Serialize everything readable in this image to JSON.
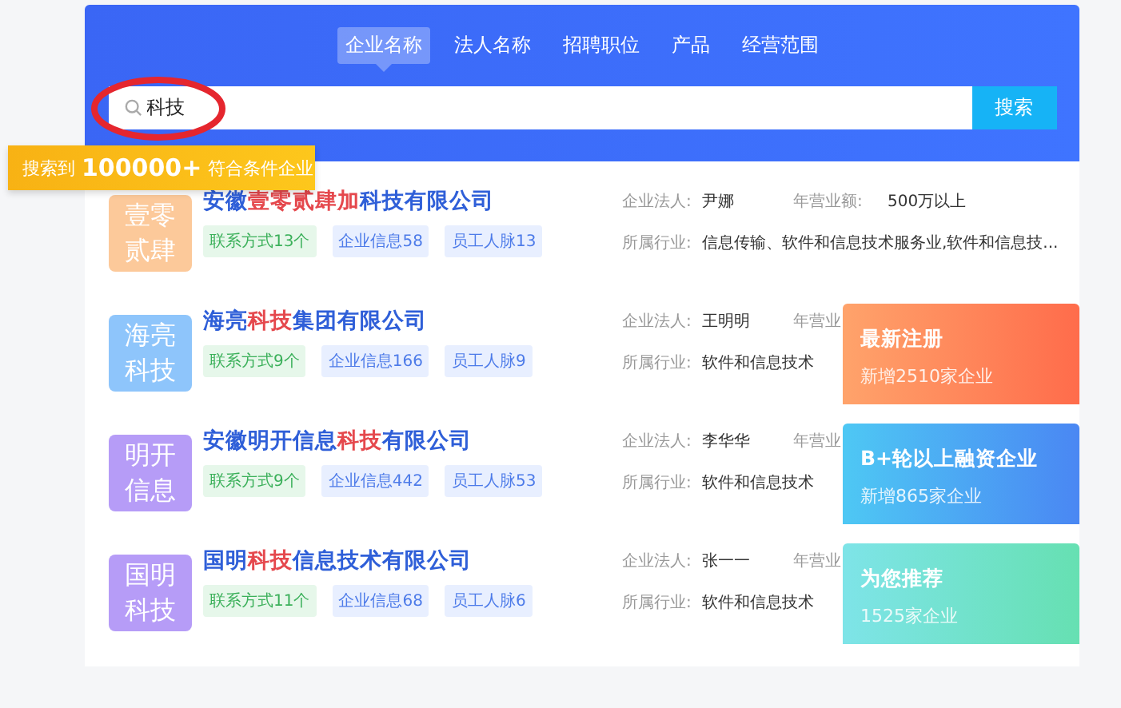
{
  "tabs": [
    {
      "label": "企业名称",
      "selected": true
    },
    {
      "label": "法人名称",
      "selected": false
    },
    {
      "label": "招聘职位",
      "selected": false
    },
    {
      "label": "产品",
      "selected": false
    },
    {
      "label": "经营范围",
      "selected": false
    }
  ],
  "search": {
    "value": "科技",
    "button": "搜索"
  },
  "banner": {
    "prefix": "搜索到",
    "count": "100000+",
    "suffix": "符合条件企业"
  },
  "results": [
    {
      "logo": "壹零贰肆",
      "color": "#fcc99a",
      "name": [
        {
          "text": "安徽",
          "highlight": false
        },
        {
          "text": "壹零贰肆加",
          "highlight": true
        },
        {
          "text": "科技有限公司",
          "highlight": false
        }
      ],
      "tags": [
        {
          "kind": "contact",
          "text": "联系方式13个"
        },
        {
          "kind": "info",
          "text": "企业信息58"
        },
        {
          "kind": "info",
          "text": "员工人脉13"
        }
      ],
      "legal_label": "企业法人:",
      "legal": "尹娜",
      "revenue_label": "年营业额:",
      "revenue": "500万以上",
      "industry_label": "所属行业:",
      "industry": "信息传输、软件和信息技术服务业,软件和信息技..."
    },
    {
      "logo": "海亮科技",
      "color": "#8ec5fb",
      "name": [
        {
          "text": "海亮",
          "highlight": false
        },
        {
          "text": "科技",
          "highlight": true
        },
        {
          "text": "集团有限公司",
          "highlight": false
        }
      ],
      "tags": [
        {
          "kind": "contact",
          "text": "联系方式9个"
        },
        {
          "kind": "info",
          "text": "企业信息166"
        },
        {
          "kind": "info",
          "text": "员工人脉9"
        }
      ],
      "legal_label": "企业法人:",
      "legal": "王明明",
      "revenue_label": "年营业",
      "industry_label": "所属行业:",
      "industry": "软件和信息技术"
    },
    {
      "logo": "明开信息",
      "color": "#b69cf7",
      "name": [
        {
          "text": "安徽明开信息",
          "highlight": false
        },
        {
          "text": "科技",
          "highlight": true
        },
        {
          "text": "有限公司",
          "highlight": false
        }
      ],
      "tags": [
        {
          "kind": "contact",
          "text": "联系方式9个"
        },
        {
          "kind": "info",
          "text": "企业信息442"
        },
        {
          "kind": "info",
          "text": "员工人脉53"
        }
      ],
      "legal_label": "企业法人:",
      "legal": "李华华",
      "revenue_label": "年营业",
      "industry_label": "所属行业:",
      "industry": "软件和信息技术"
    },
    {
      "logo": "国明科技",
      "color": "#b69cf7",
      "name": [
        {
          "text": "国明",
          "highlight": false
        },
        {
          "text": "科技",
          "highlight": true
        },
        {
          "text": "信息技术有限公司",
          "highlight": false
        }
      ],
      "tags": [
        {
          "kind": "contact",
          "text": "联系方式11个"
        },
        {
          "kind": "info",
          "text": "企业信息68"
        },
        {
          "kind": "info",
          "text": "员工人脉6"
        }
      ],
      "legal_label": "企业法人:",
      "legal": "张一一",
      "revenue_label": "年营业",
      "industry_label": "所属行业:",
      "industry": "软件和信息技术"
    }
  ],
  "promos": [
    {
      "kind": "orange",
      "title": "最新注册",
      "subtitle": "新增2510家企业"
    },
    {
      "kind": "blue",
      "title": "B+轮以上融资企业",
      "subtitle": "新增865家企业"
    },
    {
      "kind": "green",
      "title": "为您推荐",
      "subtitle": "1525家企业"
    }
  ]
}
